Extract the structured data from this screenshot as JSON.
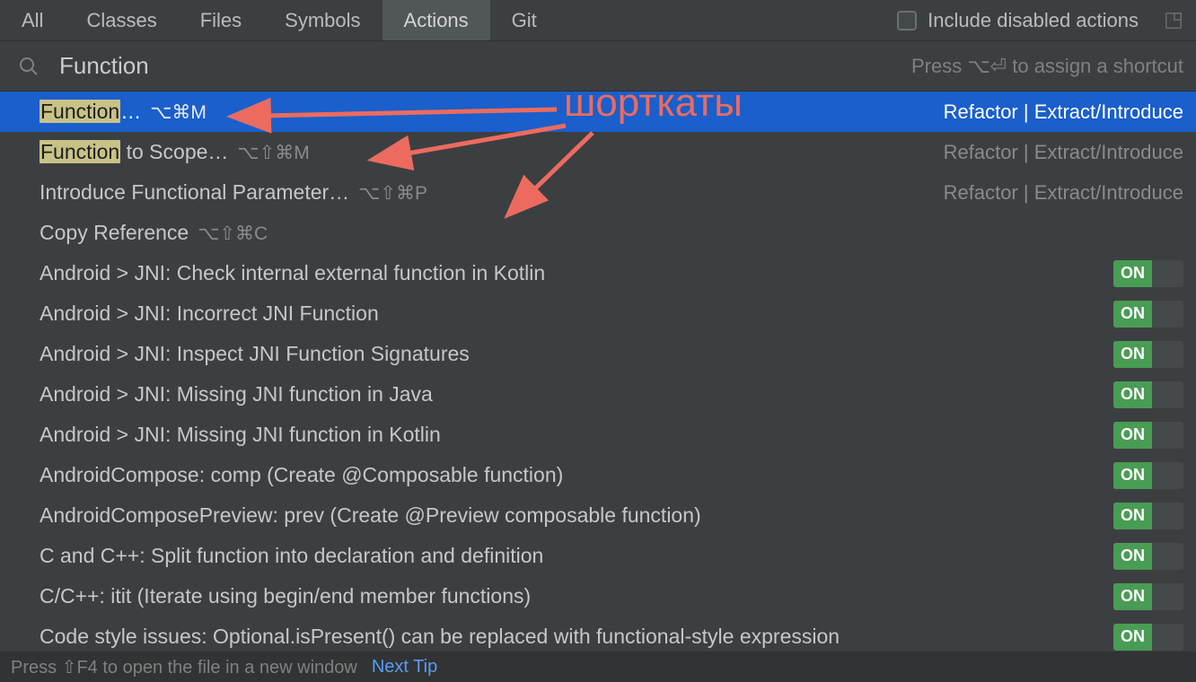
{
  "tabs": {
    "items": [
      "All",
      "Classes",
      "Files",
      "Symbols",
      "Actions",
      "Git"
    ],
    "activeIndex": 4
  },
  "includeDisabled": {
    "label": "Include disabled actions"
  },
  "search": {
    "value": "Function",
    "hint": "Press ⌥⏎ to assign a shortcut"
  },
  "results": [
    {
      "highlight": "Function",
      "labelRest": "…",
      "shortcut": "⌥⌘M",
      "category": "Refactor | Extract/Introduce",
      "selected": true
    },
    {
      "highlight": "Function",
      "labelRest": " to Scope…",
      "shortcut": "⌥⇧⌘M",
      "category": "Refactor | Extract/Introduce"
    },
    {
      "labelPlain": "Introduce Functional Parameter…",
      "shortcut": "⌥⇧⌘P",
      "category": "Refactor | Extract/Introduce"
    },
    {
      "labelPlain": "Copy Reference",
      "shortcut": "⌥⇧⌘C"
    },
    {
      "labelPlain": "Android > JNI: Check internal external function in Kotlin",
      "toggle": "ON"
    },
    {
      "labelPlain": "Android > JNI: Incorrect JNI Function",
      "toggle": "ON"
    },
    {
      "labelPlain": "Android > JNI: Inspect JNI Function Signatures",
      "toggle": "ON"
    },
    {
      "labelPlain": "Android > JNI: Missing JNI function in Java",
      "toggle": "ON"
    },
    {
      "labelPlain": "Android > JNI: Missing JNI function in Kotlin",
      "toggle": "ON"
    },
    {
      "labelPlain": "AndroidCompose: comp (Create @Composable function)",
      "toggle": "ON"
    },
    {
      "labelPlain": "AndroidComposePreview: prev (Create @Preview composable function)",
      "toggle": "ON"
    },
    {
      "labelPlain": "C and C++: Split function into declaration and definition",
      "toggle": "ON"
    },
    {
      "labelPlain": "C/C++: itit (Iterate using begin/end member functions)",
      "toggle": "ON"
    },
    {
      "labelPlain": "Code style issues: Optional.isPresent() can be replaced with functional-style expression",
      "toggle": "ON"
    }
  ],
  "footer": {
    "text": "Press ⇧F4 to open the file in a new window",
    "link": "Next Tip"
  },
  "annotation": {
    "label": "шорткаты"
  }
}
